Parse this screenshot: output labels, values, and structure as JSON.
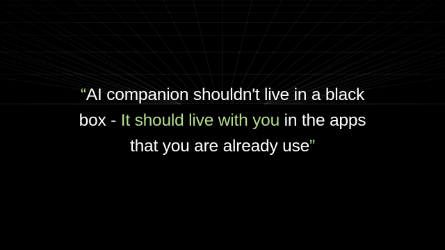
{
  "quote": {
    "open_mark": "“",
    "line1": "AI companion shouldn't live in a black",
    "line2_before": "box - ",
    "highlight": "It should live with you",
    "line2_after": " in the apps",
    "line3": "that you are already use",
    "close_mark": "”"
  },
  "colors": {
    "background": "#000000",
    "text": "#ffffff",
    "highlight": "#b5dd8f",
    "grid": "#ffffff"
  }
}
